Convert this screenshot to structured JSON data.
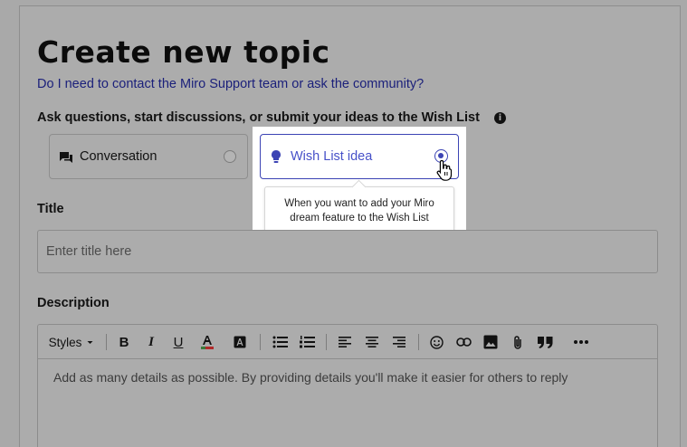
{
  "page": {
    "title": "Create new topic",
    "help_link": "Do I need to contact the Miro Support team or ask the community?",
    "topic_type_prompt": "Ask questions, start discussions, or submit your ideas to the Wish List",
    "info_icon": "info-icon"
  },
  "topic_types": {
    "conversation": {
      "label": "Conversation",
      "icon": "chat-bubble-icon",
      "selected": false
    },
    "wish_list": {
      "label": "Wish List idea",
      "icon": "lightbulb-icon",
      "selected": true
    },
    "tooltip_line1": "When you want to add your Miro",
    "tooltip_line2": "dream feature to the Wish List"
  },
  "title_field": {
    "label": "Title",
    "placeholder": "Enter title here",
    "value": ""
  },
  "description_field": {
    "label": "Description",
    "placeholder": "Add as many details as possible. By providing details you'll make it easier for others to reply",
    "toolbar": {
      "styles_label": "Styles",
      "buttons": [
        "bold",
        "italic",
        "underline",
        "text-color",
        "highlight",
        "bullet-list",
        "numbered-list",
        "align-left",
        "align-center",
        "align-right",
        "emoji",
        "link",
        "image",
        "attachment",
        "quote",
        "more"
      ]
    }
  },
  "colors": {
    "accent": "#3c44b4",
    "link": "#1a1f7a",
    "overlay": "#a9a9a9",
    "spotlight": "#ffffff"
  }
}
